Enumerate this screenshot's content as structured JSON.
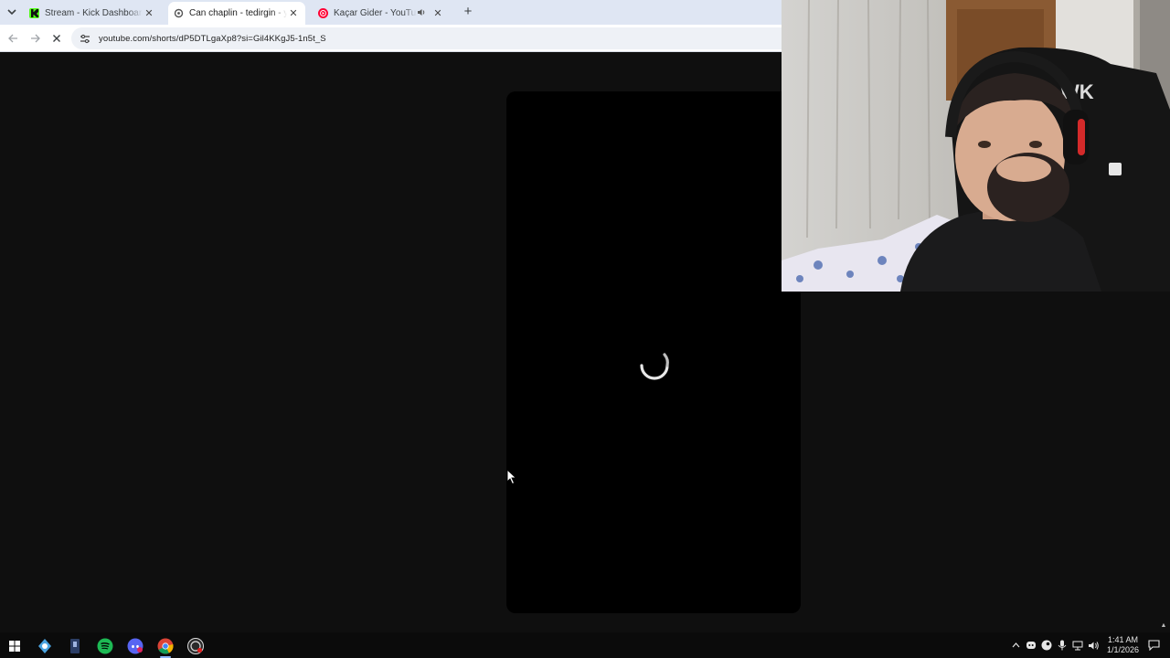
{
  "browser": {
    "tabs": [
      {
        "title": "Stream - Kick Dashboard",
        "favicon": "kick-icon",
        "active": false
      },
      {
        "title": "Can chaplin - tedirgin - yok olu",
        "favicon": "youtube-loading-icon",
        "active": true
      },
      {
        "title": "Kaçar Gider - YouTube Music",
        "favicon": "youtube-music-icon",
        "active": false,
        "playing_audio": true
      }
    ],
    "url": "youtube.com/shorts/dP5DTLgaXp8?si=Gil4KKgJ5-1n5t_S"
  },
  "taskbar": {
    "apps": [
      "windows-start-icon",
      "app-settings-icon",
      "app-file-icon",
      "spotify-icon",
      "discord-icon",
      "chrome-icon",
      "obs-icon"
    ],
    "clock": {
      "time": "1:41 AM",
      "date": "1/1/2026"
    }
  },
  "colors": {
    "page_bg": "#0f0f0f",
    "player_bg": "#000000",
    "tabbar_bg": "#dfe6f3",
    "kick_green": "#53fc18",
    "yt_red": "#ff0033"
  }
}
